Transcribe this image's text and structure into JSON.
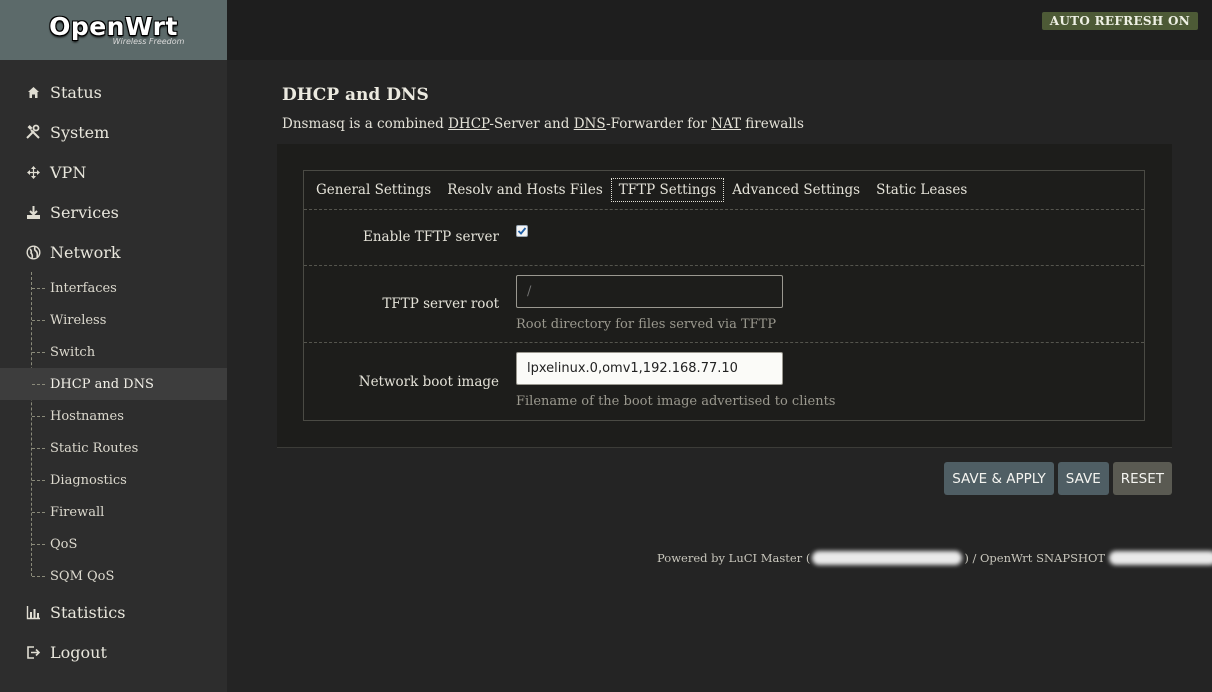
{
  "brand": {
    "name": "OpenWrt",
    "tagline": "Wireless Freedom"
  },
  "header": {
    "auto_refresh_label": "AUTO REFRESH ON"
  },
  "sidebar": {
    "items": [
      {
        "label": "Status",
        "icon": "home-icon"
      },
      {
        "label": "System",
        "icon": "tools-icon"
      },
      {
        "label": "VPN",
        "icon": "move-arrows-icon"
      },
      {
        "label": "Services",
        "icon": "download-icon"
      },
      {
        "label": "Network",
        "icon": "globe-icon"
      }
    ],
    "network_sub": [
      "Interfaces",
      "Wireless",
      "Switch",
      "DHCP and DNS",
      "Hostnames",
      "Static Routes",
      "Diagnostics",
      "Firewall",
      "QoS",
      "SQM QoS"
    ],
    "active_sub": "DHCP and DNS",
    "bottom_items": [
      {
        "label": "Statistics",
        "icon": "bar-chart-icon"
      },
      {
        "label": "Logout",
        "icon": "logout-icon"
      }
    ]
  },
  "page": {
    "title": "DHCP and DNS",
    "desc_prefix": "Dnsmasq is a combined ",
    "desc_dhcp": "DHCP",
    "desc_mid1": "-Server and ",
    "desc_dns": "DNS",
    "desc_mid2": "-Forwarder for ",
    "desc_nat": "NAT",
    "desc_suffix": " firewalls"
  },
  "tabs": [
    "General Settings",
    "Resolv and Hosts Files",
    "TFTP Settings",
    "Advanced Settings",
    "Static Leases"
  ],
  "active_tab": "TFTP Settings",
  "form": {
    "enable_tftp_label": "Enable TFTP server",
    "enable_tftp_checked": true,
    "root_label": "TFTP server root",
    "root_placeholder": "/",
    "root_hint": "Root directory for files served via TFTP",
    "boot_label": "Network boot image",
    "boot_value": "lpxelinux.0,omv1,192.168.77.10",
    "boot_hint": "Filename of the boot image advertised to clients"
  },
  "buttons": {
    "save_apply": "SAVE & APPLY",
    "save": "SAVE",
    "reset": "RESET"
  },
  "footer": {
    "powered_by": "Powered by LuCI Master (",
    "mid": ") / OpenWrt SNAPSHOT"
  },
  "colors": {
    "sidebar_bg": "#2d2d2d",
    "logo_bg": "#5c6a6a",
    "auto_refresh_bg": "#4d5a36",
    "button_primary": "#4f5e64",
    "button_reset": "#5a5a52"
  }
}
